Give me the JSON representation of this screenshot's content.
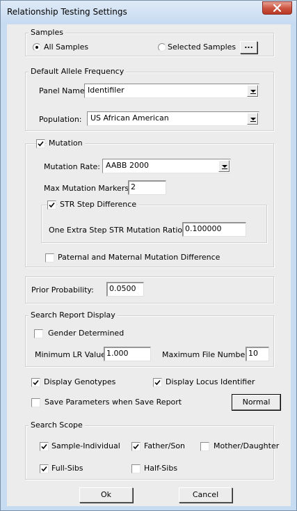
{
  "window": {
    "title": "Relationship Testing Settings"
  },
  "samples": {
    "legend": "Samples",
    "all_label": "All Samples",
    "selected_label": "Selected Samples",
    "browse_label": "..."
  },
  "allele": {
    "legend": "Default Allele Frequency",
    "panel_label": "Panel Name:",
    "panel_value": "Identifiler",
    "population_label": "Population:",
    "population_value": "US African American"
  },
  "mutation": {
    "label": "Mutation",
    "rate_label": "Mutation Rate:",
    "rate_value": "AABB 2000",
    "max_label": "Max Mutation Markers:",
    "max_value": "2",
    "str_label": "STR Step Difference",
    "ratio_label": "One Extra Step STR Mutation Ratio:",
    "ratio_value": "0.100000",
    "paternal_label": "Paternal and Maternal Mutation Difference"
  },
  "prior": {
    "label": "Prior Probability:",
    "value": "0.0500"
  },
  "search_report": {
    "legend": "Search Report Display",
    "gender_label": "Gender Determined",
    "min_lr_label": "Minimum LR Value:",
    "min_lr_value": "1.000",
    "max_file_label": "Maximum File Number:",
    "max_file_value": "10"
  },
  "options": {
    "display_genotypes": "Display Genotypes",
    "display_locus": "Display Locus Identifier",
    "save_params": "Save Parameters when  Save Report",
    "normal_button": "Normal"
  },
  "search_scope": {
    "legend": "Search Scope",
    "sample_individual": "Sample-Individual",
    "father_son": "Father/Son",
    "mother_daughter": "Mother/Daughter",
    "full_sibs": "Full-Sibs",
    "half_sibs": "Half-Sibs"
  },
  "buttons": {
    "ok": "Ok",
    "cancel": "Cancel"
  },
  "colors": {
    "title_bar": "#c7dcf1",
    "close_button": "#c9513d",
    "dialog_bg": "#ececec"
  }
}
